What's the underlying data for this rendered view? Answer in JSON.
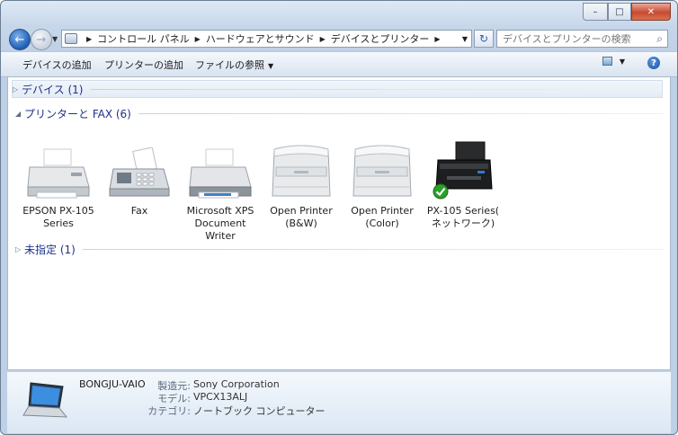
{
  "window": {
    "caption_buttons": {
      "minimize": "–",
      "maximize": "□",
      "close": "✕"
    }
  },
  "address": {
    "crumbs": [
      "コントロール パネル",
      "ハードウェアとサウンド",
      "デバイスとプリンター"
    ],
    "search_placeholder": "デバイスとプリンターの検索"
  },
  "toolbar": {
    "add_device": "デバイスの追加",
    "add_printer": "プリンターの追加",
    "browse_files": "ファイルの参照",
    "help": "?"
  },
  "groups": {
    "devices": "デバイス (1)",
    "printers": "プリンターと FAX (6)",
    "unspecified": "未指定 (1)"
  },
  "printers": [
    {
      "label": "EPSON PX-105\nSeries",
      "icon": "inkjet-printer-icon"
    },
    {
      "label": "Fax",
      "icon": "fax-machine-icon"
    },
    {
      "label": "Microsoft XPS\nDocument\nWriter",
      "icon": "inkjet-printer-icon"
    },
    {
      "label": "Open Printer\n(B&W)",
      "icon": "laser-printer-icon"
    },
    {
      "label": "Open Printer\n(Color)",
      "icon": "laser-printer-icon"
    },
    {
      "label": "PX-105 Series(\nネットワーク)",
      "icon": "black-printer-default-icon"
    }
  ],
  "details": {
    "name": "BONGJU-VAIO",
    "manufacturer_key": "製造元:",
    "manufacturer": "Sony Corporation",
    "model_key": "モデル:",
    "model": "VPCX13ALJ",
    "category_key": "カテゴリ:",
    "category": "ノートブック コンピューター"
  },
  "colors": {
    "accent": "#1e3287",
    "frame": "#bed0e6",
    "default_check": "#2aa02a"
  }
}
